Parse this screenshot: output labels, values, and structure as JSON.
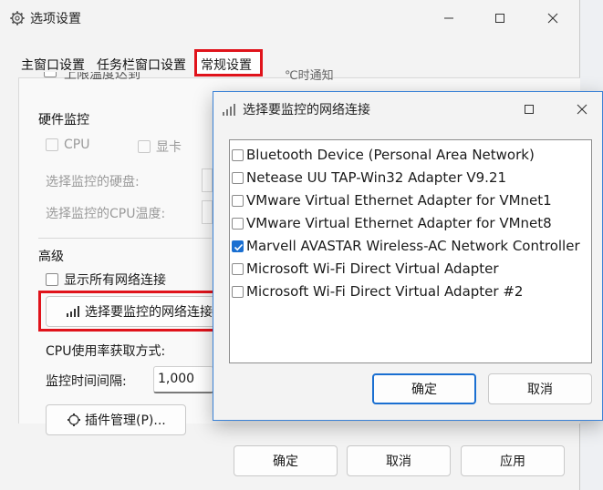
{
  "window": {
    "title": "选项设置",
    "minimize_icon": "minimize-icon",
    "maximize_icon": "maximize-icon",
    "close_icon": "close-icon"
  },
  "tabs": [
    {
      "label": "主窗口设置"
    },
    {
      "label": "任务栏窗口设置"
    },
    {
      "label": "常规设置",
      "active": true
    }
  ],
  "general": {
    "cut_off_checkbox_label": "上限温度达到",
    "cut_off_right_text": "℃时通知",
    "hardware_group": "硬件监控",
    "cpu_label": "CPU",
    "gpu_label": "显卡",
    "select_disk_label": "选择监控的硬盘:",
    "select_cpu_temp_label": "选择监控的CPU温度:",
    "advanced_group": "高级",
    "show_all_net_label": "显示所有网络连接",
    "select_net_button": "选择要监控的网络连接",
    "cpu_usage_method_label": "CPU使用率获取方式:",
    "monitor_interval_label": "监控时间间隔:",
    "monitor_interval_value": "1,000",
    "plugin_button": "插件管理(P)..."
  },
  "footer": {
    "ok": "确定",
    "cancel": "取消",
    "apply": "应用"
  },
  "dialog": {
    "title": "选择要监控的网络连接",
    "items": [
      {
        "label": "Bluetooth Device (Personal Area Network)",
        "checked": false
      },
      {
        "label": "Netease UU TAP-Win32 Adapter V9.21",
        "checked": false
      },
      {
        "label": "VMware Virtual Ethernet Adapter for VMnet1",
        "checked": false
      },
      {
        "label": "VMware Virtual Ethernet Adapter for VMnet8",
        "checked": false
      },
      {
        "label": "Marvell AVASTAR Wireless-AC Network Controller",
        "checked": true
      },
      {
        "label": "Microsoft Wi-Fi Direct Virtual Adapter",
        "checked": false
      },
      {
        "label": "Microsoft Wi-Fi Direct Virtual Adapter #2",
        "checked": false
      }
    ],
    "ok": "确定",
    "cancel": "取消"
  },
  "colors": {
    "accent": "#1a6fd1",
    "highlight_red": "#e0131b",
    "dialog_border": "#3b82d6"
  }
}
